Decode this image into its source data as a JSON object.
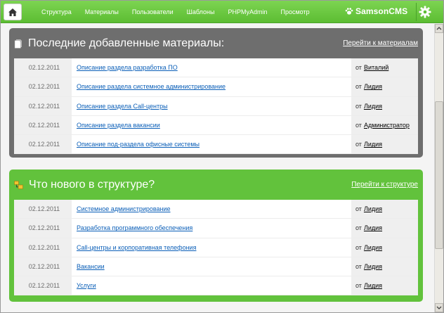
{
  "nav": {
    "home_icon": "home-icon",
    "items": [
      "Структура",
      "Материалы",
      "Пользователи",
      "Шаблоны",
      "PHPMyAdmin",
      "Просмотр"
    ],
    "brand": "SamsonCMS",
    "brand_icon": "paw-icon",
    "settings_icon": "gear-icon"
  },
  "recent_materials": {
    "title": "Последние добавленные материалы:",
    "link": "Перейти к материалам",
    "icon": "document-icon",
    "by_label": "от",
    "rows": [
      {
        "date": "02.12.2011",
        "title": "Описание раздела разработка ПО",
        "author": "Виталий"
      },
      {
        "date": "02.12.2011",
        "title": "Описание раздела системное администрирование",
        "author": "Лидия"
      },
      {
        "date": "02.12.2011",
        "title": "Описание раздела Call-центры",
        "author": "Лидия"
      },
      {
        "date": "02.12.2011",
        "title": "Описание раздела вакансии",
        "author": "Администратор"
      },
      {
        "date": "02.12.2011",
        "title": "Описание под-раздела офисные системы",
        "author": "Лидия"
      }
    ]
  },
  "structure_news": {
    "title": "Что нового в структуре?",
    "link": "Перейти к структуре",
    "icon": "structure-icon",
    "by_label": "от",
    "rows": [
      {
        "date": "02.12.2011",
        "title": "Системное администрирование",
        "author": "Лидия"
      },
      {
        "date": "02.12.2011",
        "title": "Разработка программного обеспечения",
        "author": "Лидия"
      },
      {
        "date": "02.12.2011",
        "title": "Call-центры и корпоративная телефония",
        "author": "Лидия"
      },
      {
        "date": "02.12.2011",
        "title": "Вакансии",
        "author": "Лидия"
      },
      {
        "date": "02.12.2011",
        "title": "Услуги",
        "author": "Лидия"
      }
    ]
  }
}
